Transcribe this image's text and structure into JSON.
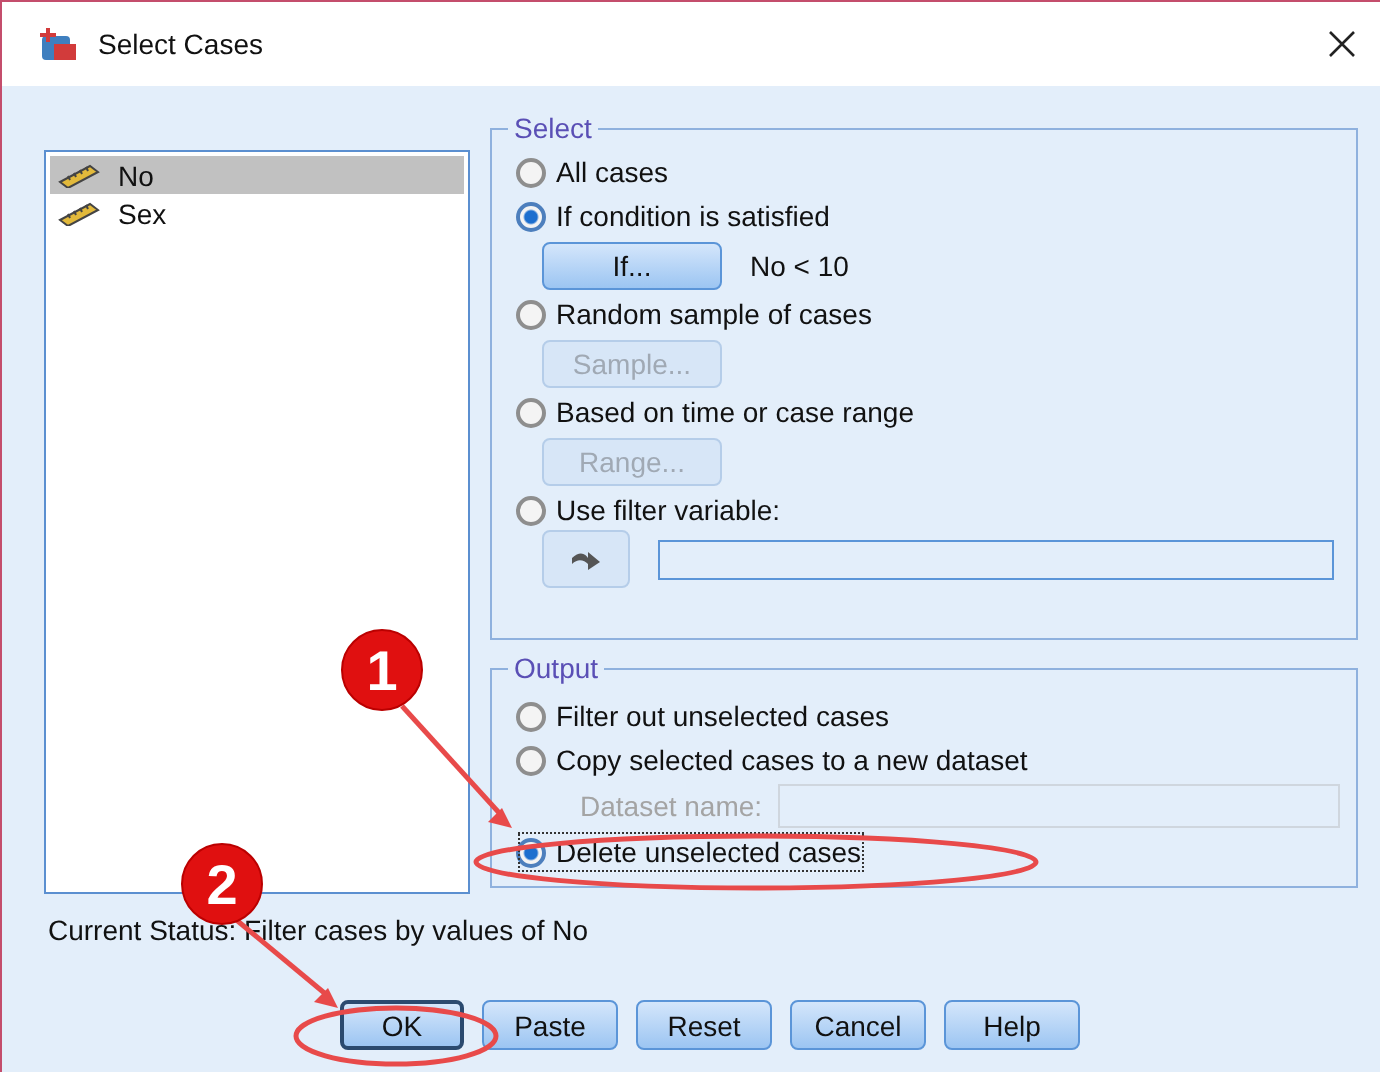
{
  "window": {
    "title": "Select Cases"
  },
  "variables": [
    {
      "name": "No",
      "selected": true
    },
    {
      "name": "Sex",
      "selected": false
    }
  ],
  "select_group": {
    "title": "Select",
    "options": [
      {
        "kind": "radio",
        "label": "All cases",
        "selected": false
      },
      {
        "kind": "radio",
        "label": "If condition is satisfied",
        "selected": true
      },
      {
        "kind": "button-row",
        "button": "If...",
        "disabled": false,
        "condition": "No < 10"
      },
      {
        "kind": "radio",
        "label": "Random sample of cases",
        "selected": false
      },
      {
        "kind": "button-row",
        "button": "Sample...",
        "disabled": true
      },
      {
        "kind": "radio",
        "label": "Based on time or case range",
        "selected": false
      },
      {
        "kind": "button-row",
        "button": "Range...",
        "disabled": true
      },
      {
        "kind": "radio",
        "label": "Use filter variable:",
        "selected": false
      },
      {
        "kind": "filter-row"
      }
    ]
  },
  "output_group": {
    "title": "Output",
    "options": [
      {
        "kind": "radio",
        "label": "Filter out unselected cases",
        "selected": false
      },
      {
        "kind": "radio",
        "label": "Copy selected cases to a new dataset",
        "selected": false
      },
      {
        "kind": "field",
        "label": "Dataset name:",
        "disabled": true
      },
      {
        "kind": "radio",
        "label": "Delete unselected cases",
        "selected": true
      }
    ]
  },
  "status": "Current Status: Filter cases by values of No",
  "buttons": [
    {
      "label": "OK",
      "default": true
    },
    {
      "label": "Paste",
      "default": false
    },
    {
      "label": "Reset",
      "default": false
    },
    {
      "label": "Cancel",
      "default": false
    },
    {
      "label": "Help",
      "default": false
    }
  ],
  "annotations": [
    {
      "label": "1"
    },
    {
      "label": "2"
    }
  ]
}
